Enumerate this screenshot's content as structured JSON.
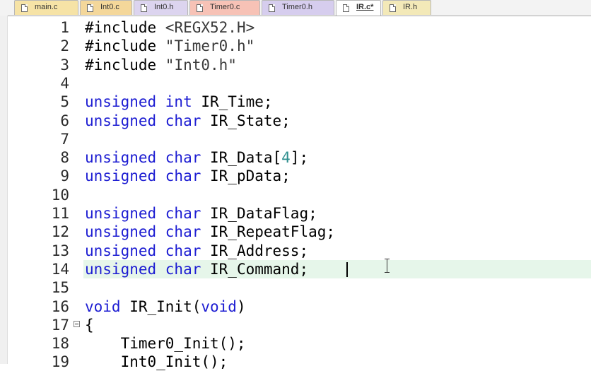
{
  "tabs": [
    {
      "label": "main.c",
      "color": "#f6e3a6"
    },
    {
      "label": "Int0.c",
      "color": "#f4d79a"
    },
    {
      "label": "Int0.h",
      "color": "#dcd4ef"
    },
    {
      "label": "Timer0.c",
      "color": "#f7c2b6"
    },
    {
      "label": "Timer0.h",
      "color": "#d6cdee"
    },
    {
      "label": "IR.c*",
      "color": "#ffffff"
    },
    {
      "label": "IR.h",
      "color": "#f3e9b8"
    }
  ],
  "editor": {
    "current_line": 14,
    "lines": [
      {
        "num": "1",
        "parts": [
          {
            "t": "#include "
          },
          {
            "t": "<REGX52.H>",
            "c": "str"
          }
        ]
      },
      {
        "num": "2",
        "parts": [
          {
            "t": "#include "
          },
          {
            "t": "\"Timer0.h\"",
            "c": "str"
          }
        ]
      },
      {
        "num": "3",
        "parts": [
          {
            "t": "#include "
          },
          {
            "t": "\"Int0.h\"",
            "c": "str"
          }
        ]
      },
      {
        "num": "4",
        "parts": []
      },
      {
        "num": "5",
        "parts": [
          {
            "t": "unsigned int",
            "c": "kw"
          },
          {
            "t": " IR_Time;"
          }
        ]
      },
      {
        "num": "6",
        "parts": [
          {
            "t": "unsigned char",
            "c": "kw"
          },
          {
            "t": " IR_State;"
          }
        ]
      },
      {
        "num": "7",
        "parts": []
      },
      {
        "num": "8",
        "parts": [
          {
            "t": "unsigned char",
            "c": "kw"
          },
          {
            "t": " IR_Data["
          },
          {
            "t": "4",
            "c": "num"
          },
          {
            "t": "];"
          }
        ]
      },
      {
        "num": "9",
        "parts": [
          {
            "t": "unsigned char",
            "c": "kw"
          },
          {
            "t": " IR_pData;"
          }
        ]
      },
      {
        "num": "10",
        "parts": []
      },
      {
        "num": "11",
        "parts": [
          {
            "t": "unsigned char",
            "c": "kw"
          },
          {
            "t": " IR_DataFlag;"
          }
        ]
      },
      {
        "num": "12",
        "parts": [
          {
            "t": "unsigned char",
            "c": "kw"
          },
          {
            "t": " IR_RepeatFlag;"
          }
        ]
      },
      {
        "num": "13",
        "parts": [
          {
            "t": "unsigned char",
            "c": "kw"
          },
          {
            "t": " IR_Address;"
          }
        ]
      },
      {
        "num": "14",
        "parts": [
          {
            "t": "unsigned char",
            "c": "kw"
          },
          {
            "t": " IR_Command;"
          }
        ]
      },
      {
        "num": "15",
        "parts": []
      },
      {
        "num": "16",
        "parts": [
          {
            "t": "void",
            "c": "kw"
          },
          {
            "t": " IR_Init("
          },
          {
            "t": "void",
            "c": "kw"
          },
          {
            "t": ")"
          }
        ]
      },
      {
        "num": "17",
        "parts": [
          {
            "t": "{"
          }
        ],
        "fold": true
      },
      {
        "num": "18",
        "parts": [
          {
            "t": "    Timer0_Init();"
          }
        ]
      },
      {
        "num": "19",
        "parts": [
          {
            "t": "    Int0_Init();"
          }
        ]
      }
    ]
  }
}
